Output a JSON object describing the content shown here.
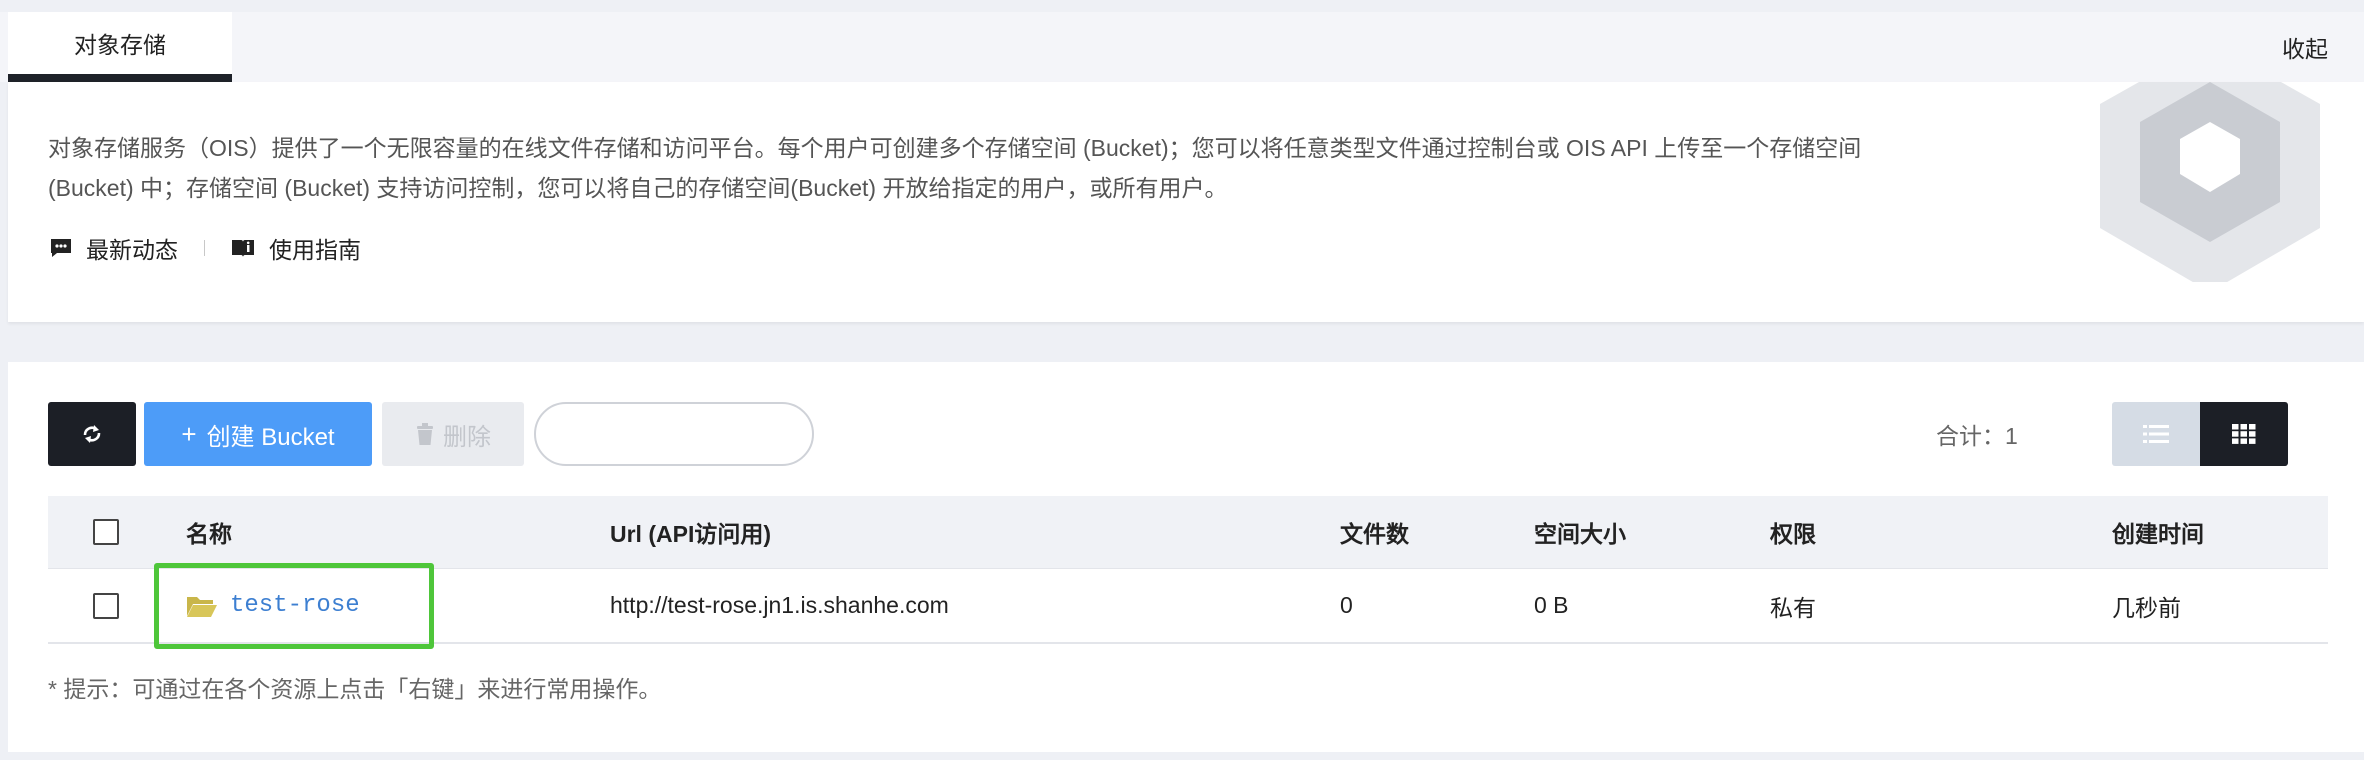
{
  "tabbar": {
    "active_tab": "对象存储",
    "collapse_label": "收起"
  },
  "intro": {
    "description_line1": "对象存储服务（OIS）提供了一个无限容量的在线文件存储和访问平台。每个用户可创建多个存储空间 (Bucket)；您可以将任意类型文件通过控制台或 OIS API 上传至一个存储空间",
    "description_line2": "(Bucket) 中；存储空间 (Bucket) 支持访问控制，您可以将自己的存储空间(Bucket) 开放给指定的用户，或所有用户。",
    "news_label": "最新动态",
    "guide_label": "使用指南"
  },
  "toolbar": {
    "create_label": "创建 Bucket",
    "create_plus": "+",
    "delete_label": "删除",
    "search_value": "",
    "search_placeholder": "",
    "total_label": "合计：1"
  },
  "table": {
    "columns": [
      "名称",
      "Url (API访问用)",
      "文件数",
      "空间大小",
      "权限",
      "创建时间"
    ],
    "rows": [
      {
        "name": "test-rose",
        "url": "http://test-rose.jn1.is.shanhe.com",
        "files": "0",
        "size": "0 B",
        "permission": "私有",
        "created": "几秒前"
      }
    ]
  },
  "tip": "* 提示：可通过在各个资源上点击「右键」来进行常用操作。",
  "colors": {
    "primary_button": "#4d9cf8",
    "dark_button": "#1c1f26",
    "highlight_box": "#4ec63a",
    "link": "#3d7fd1",
    "folder_icon": "#c9b64a"
  },
  "icons": [
    "refresh-icon",
    "trash-icon",
    "list-view-icon",
    "grid-view-icon",
    "chat-icon",
    "book-icon",
    "folder-open-icon",
    "hexagon-logo"
  ]
}
